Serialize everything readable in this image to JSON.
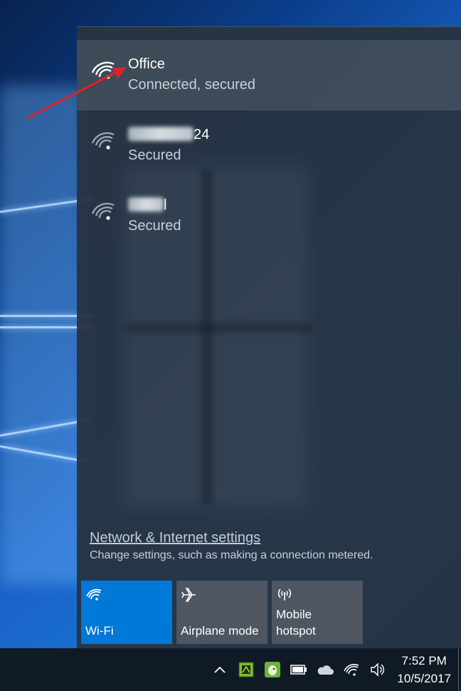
{
  "networks": [
    {
      "name": "Office",
      "status": "Connected, secured",
      "connected": true
    },
    {
      "name_visible": "24",
      "status": "Secured",
      "connected": false
    },
    {
      "name_visible": "l",
      "status": "Secured",
      "connected": false
    }
  ],
  "settings": {
    "link": "Network & Internet settings",
    "description": "Change settings, such as making a connection metered."
  },
  "tiles": [
    {
      "label": "Wi-Fi",
      "icon": "wifi-icon",
      "active": true
    },
    {
      "label": "Airplane mode",
      "icon": "airplane-icon",
      "active": false
    },
    {
      "label": "Mobile\nhotspot",
      "label_line1": "Mobile",
      "label_line2": "hotspot",
      "icon": "hotspot-icon",
      "active": false
    }
  ],
  "taskbar": {
    "time": "7:52 PM",
    "date": "10/5/2017",
    "tray_icons": [
      "chevron-up-icon",
      "app-icon-green",
      "evernote-icon",
      "battery-icon",
      "onedrive-icon",
      "wifi-icon",
      "volume-icon"
    ]
  },
  "colors": {
    "accent": "#0078d7",
    "annotation": "#e0202a",
    "flyout_bg": "#283442"
  }
}
